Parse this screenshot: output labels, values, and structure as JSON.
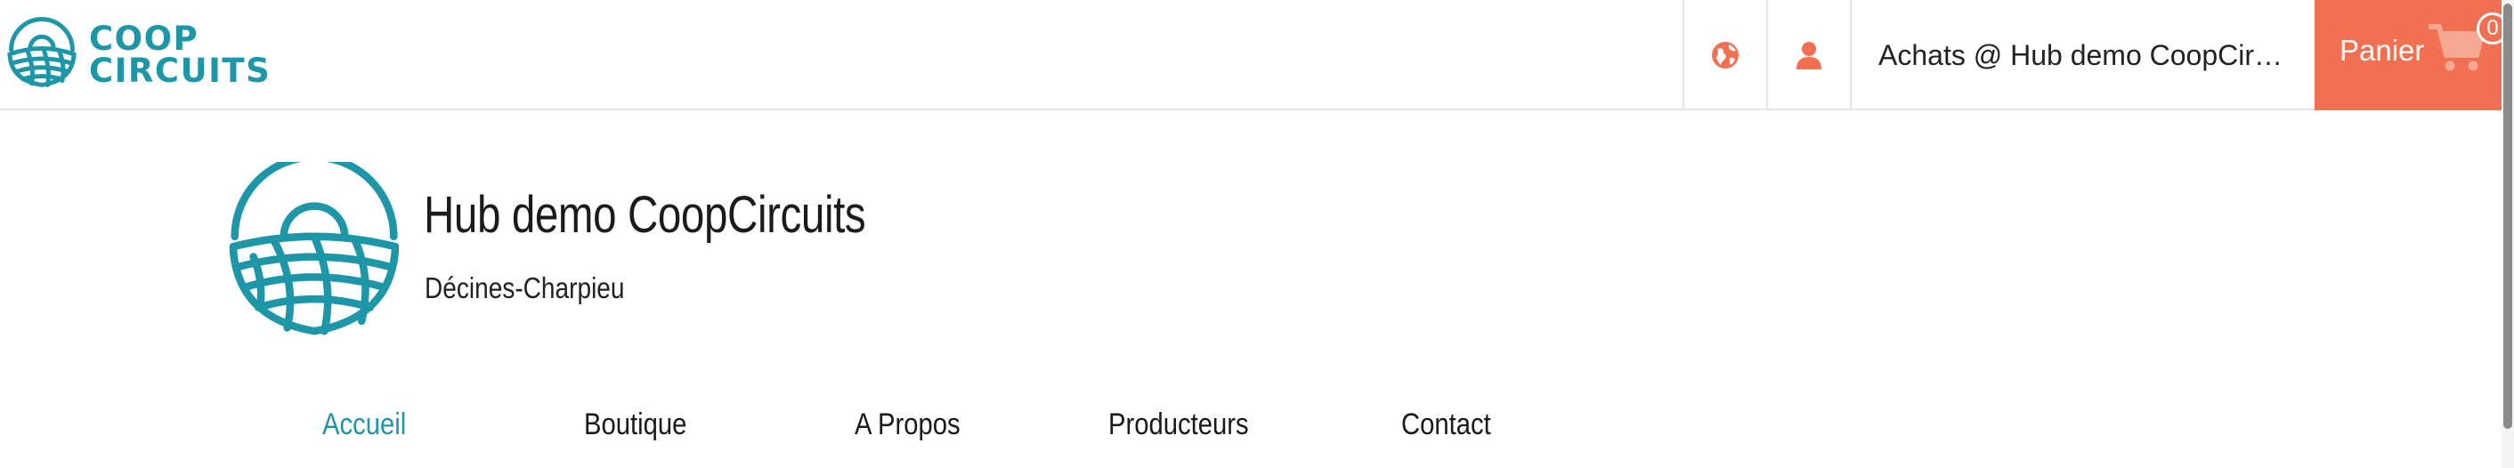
{
  "header": {
    "logo": {
      "line1": "COOP",
      "line2": "CIRCUITS",
      "icon": "basket-logo-icon",
      "color": "#1d97a8"
    },
    "language_icon": "globe-icon",
    "account_icon": "user-icon",
    "shop_label": "Achats @ Hub demo CoopCircuits",
    "cart": {
      "label": "Panier",
      "count": "0",
      "icon": "cart-icon",
      "color": "#f27052"
    }
  },
  "hub": {
    "name": "Hub demo CoopCircuits",
    "city": "Décines-Charpieu",
    "logo_icon": "basket-logo-icon"
  },
  "tabs": [
    {
      "label": "Accueil",
      "active": true
    },
    {
      "label": "Boutique",
      "active": false
    },
    {
      "label": "A Propos",
      "active": false
    },
    {
      "label": "Producteurs",
      "active": false
    },
    {
      "label": "Contact",
      "active": false
    }
  ],
  "colors": {
    "accent": "#1d97a8",
    "cart": "#f27052",
    "icon": "#f27052"
  }
}
